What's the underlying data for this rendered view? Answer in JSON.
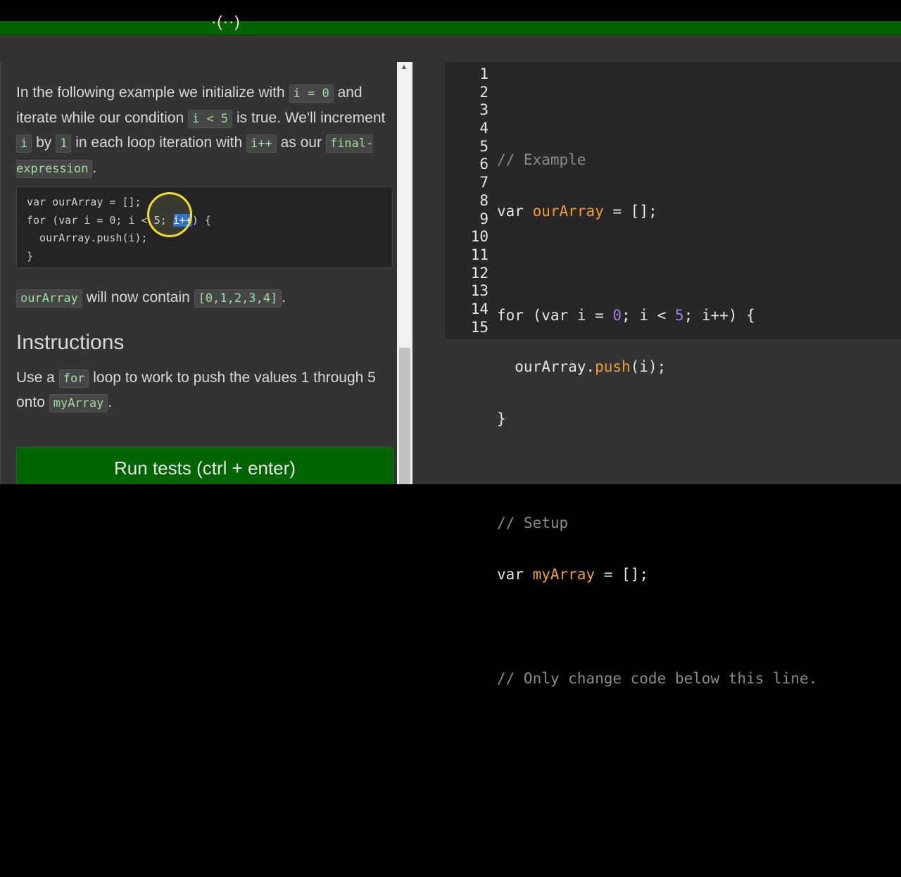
{
  "header": {
    "title_fragment": "·(··)"
  },
  "description": {
    "p1_a": "In the following example we initialize with",
    "code_i0": "i = 0",
    "p1_b": "and iterate while our condition",
    "code_cond": "i < 5",
    "p1_c": "is true. We'll increment",
    "code_i": "i",
    "p1_d": "by",
    "code_1": "1",
    "p1_e": "in each loop iteration with",
    "code_inc": "i++",
    "p1_f": "as our",
    "code_final": "final-expression",
    "p1_g": "."
  },
  "example_code": {
    "line1": "var ourArray = [];",
    "line2_a": "for (var i = 0; i < 5; ",
    "line2_sel": "i++",
    "line2_b": ") {",
    "line3": "  ourArray.push(i);",
    "line4": "}"
  },
  "after_code": {
    "code_arr": "ourArray",
    "text": "will now contain",
    "code_vals": "[0,1,2,3,4]",
    "end": "."
  },
  "instructions": {
    "heading": "Instructions",
    "a": "Use a",
    "code_for": "for",
    "b": "loop to work to push the values 1 through 5 onto",
    "code_my": "myArray",
    "c": "."
  },
  "run_button": {
    "label": "Run tests (ctrl + enter)"
  },
  "editor": {
    "line_numbers": [
      "1",
      "2",
      "3",
      "4",
      "5",
      "6",
      "7",
      "8",
      "9",
      "10",
      "11",
      "12",
      "13",
      "14",
      "15"
    ],
    "comment_example": "// Example",
    "comment_setup": "// Setup",
    "comment_only": "// Only change code below this line."
  },
  "colors": {
    "green_bar": "#006400",
    "editor_bg": "#272727",
    "selection": "#1e63c8",
    "cursor_ring": "#f2e11f"
  }
}
